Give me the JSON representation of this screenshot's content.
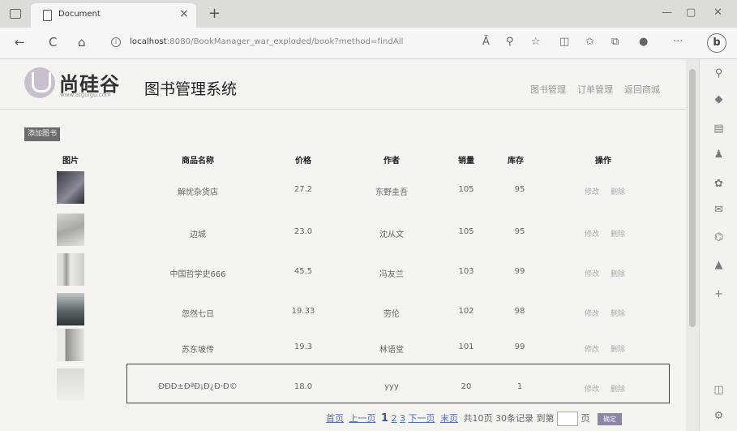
{
  "browser": {
    "tab_title": "Document",
    "tab_close": "×",
    "new_tab": "+",
    "minimize": "—",
    "restore": "▢",
    "close": "✕",
    "url_host": "localhost",
    "url_path": ":8080/BookManager_war_exploded/book?method=findAll",
    "back": "←",
    "reload": "C",
    "home": "⌂",
    "read_aloud": "Ã",
    "more": "···",
    "bing": "b"
  },
  "header": {
    "logo_text": "尚硅谷",
    "logo_sub": "www.atguigu.com",
    "system_title": "图书管理系统",
    "nav": [
      "图书管理",
      "订单管理",
      "返回商城"
    ]
  },
  "toolbar": {
    "add_label": "添加图书"
  },
  "table": {
    "headers": [
      "图片",
      "商品名称",
      "价格",
      "作者",
      "销量",
      "库存",
      "操作"
    ],
    "rows": [
      {
        "name": "解忧杂货店",
        "price": "27.2",
        "author": "东野圭吾",
        "sales": "105",
        "stock": "95",
        "edit": "修改",
        "delete": "删除"
      },
      {
        "name": "边城",
        "price": "23.0",
        "author": "沈从文",
        "sales": "105",
        "stock": "95",
        "edit": "修改",
        "delete": "删除"
      },
      {
        "name": "中国哲学史666",
        "price": "45.5",
        "author": "冯友兰",
        "sales": "103",
        "stock": "99",
        "edit": "修改",
        "delete": "删除"
      },
      {
        "name": "忽然七日",
        "price": "19.33",
        "author": "劳伦",
        "sales": "102",
        "stock": "98",
        "edit": "修改",
        "delete": "删除"
      },
      {
        "name": "苏东坡传",
        "price": "19.3",
        "author": "林语堂",
        "sales": "101",
        "stock": "99",
        "edit": "修改",
        "delete": "删除"
      },
      {
        "name": "ÐÐÐ±ÐªÐ¡Ð¿Ð·Ð©",
        "price": "18.0",
        "author": "yyy",
        "sales": "20",
        "stock": "1",
        "edit": "修改",
        "delete": "删除"
      }
    ]
  },
  "pager": {
    "first": "首页",
    "prev": "上一页",
    "pages": [
      "1",
      "2",
      "3"
    ],
    "current": "1",
    "next": "下一页",
    "last": "末页",
    "total_pages": "共10页",
    "total_records": "30条记录",
    "goto_label": "到第",
    "page_suffix": "页",
    "go_label": "确定"
  },
  "colors": {
    "page_bg": "#f5f4f1",
    "link": "#5570b0",
    "button": "#6d6b69"
  }
}
